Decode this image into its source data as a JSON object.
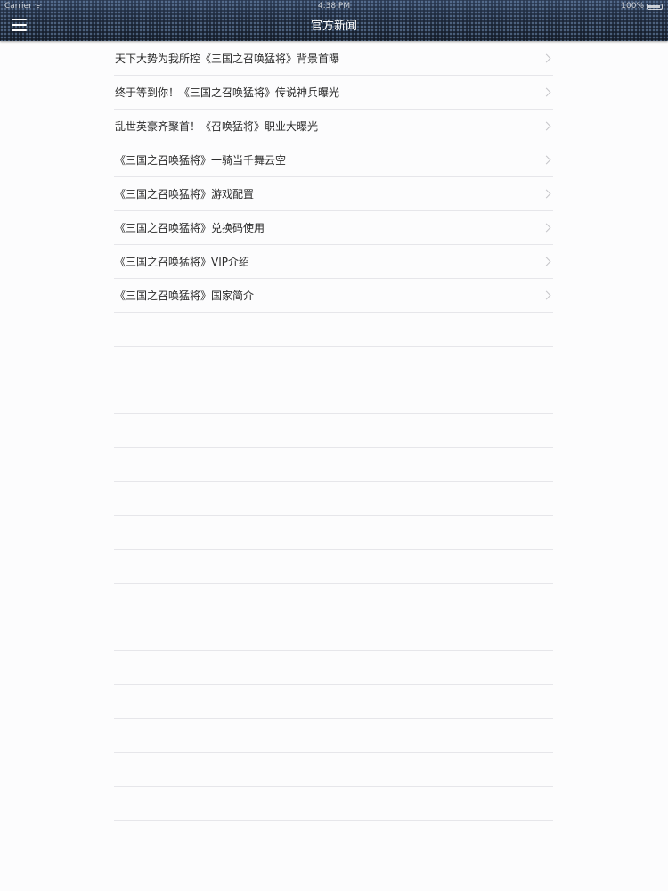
{
  "status_bar": {
    "carrier": "Carrier ᯤ",
    "time": "4:38 PM",
    "battery": "100%"
  },
  "nav": {
    "title": "官方新闻",
    "menu_icon": "hamburger-menu-icon"
  },
  "news_items": [
    {
      "title": "天下大势为我所控《三国之召唤猛将》背景首曝",
      "icon": "chevron-right-icon"
    },
    {
      "title": "终于等到你！《三国之召唤猛将》传说神兵曝光",
      "icon": "chevron-right-icon"
    },
    {
      "title": "乱世英豪齐聚首！《召唤猛将》职业大曝光",
      "icon": "chevron-right-icon"
    },
    {
      "title": "《三国之召唤猛将》一骑当千舞云空",
      "icon": "chevron-right-icon"
    },
    {
      "title": "《三国之召唤猛将》游戏配置",
      "icon": "chevron-right-icon"
    },
    {
      "title": "《三国之召唤猛将》兑换码使用",
      "icon": "chevron-right-icon"
    },
    {
      "title": "《三国之召唤猛将》VIP介绍",
      "icon": "chevron-right-icon"
    },
    {
      "title": "《三国之召唤猛将》国家简介",
      "icon": "chevron-right-icon"
    }
  ],
  "colors": {
    "nav_background": "#1d2838",
    "list_background": "#fcfcfd",
    "separator": "#e6e6ea",
    "text": "#2a2a2a"
  }
}
